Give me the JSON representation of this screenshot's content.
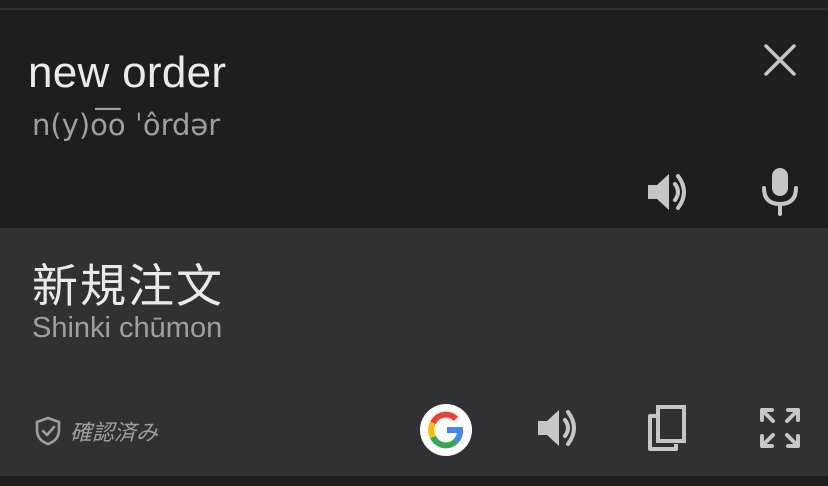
{
  "source": {
    "text": "new order",
    "phonetic": "n(y)o͞o ˈôrdər"
  },
  "target": {
    "text": "新規注文",
    "romanization": "Shinki chūmon"
  },
  "footer": {
    "verified_label": "確認済み"
  },
  "icons": {
    "close": "close-icon",
    "source_speaker": "speaker-icon",
    "microphone": "microphone-icon",
    "verified": "shield-check-icon",
    "google": "google-logo-icon",
    "target_speaker": "speaker-icon",
    "copy": "copy-icon",
    "fullscreen": "fullscreen-icon"
  },
  "colors": {
    "source_bg": "#1e1e1f",
    "target_bg": "#303134",
    "primary_text": "#e8eaed",
    "secondary_text": "#9aa0a6",
    "icon": "#c4c7c5"
  }
}
